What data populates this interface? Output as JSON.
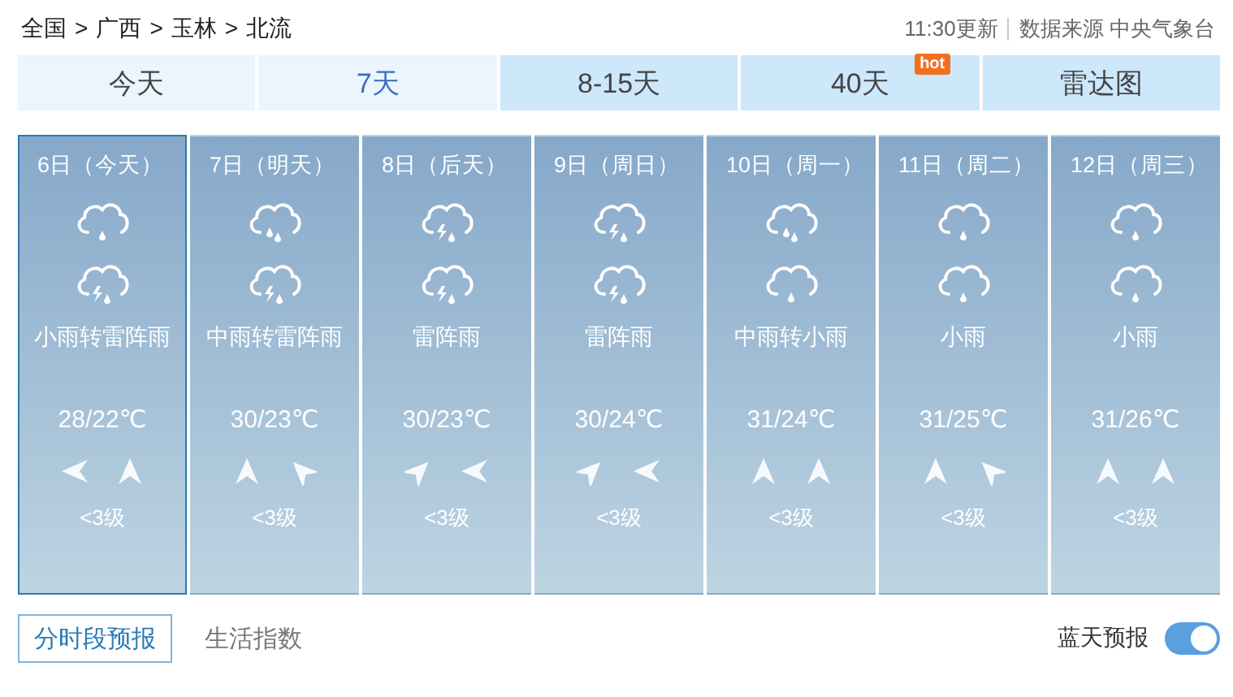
{
  "breadcrumb": [
    "全国",
    "广西",
    "玉林",
    "北流"
  ],
  "breadcrumb_separator": ">",
  "update_time": "11:30更新",
  "source": "数据来源 中央气象台",
  "tabs": [
    {
      "label": "今天",
      "selected": false,
      "kind": "basic"
    },
    {
      "label": "7天",
      "selected": true,
      "kind": "basic"
    },
    {
      "label": "8-15天",
      "selected": false,
      "kind": "extended"
    },
    {
      "label": "40天",
      "selected": false,
      "kind": "extended",
      "badge": "hot"
    },
    {
      "label": "雷达图",
      "selected": false,
      "kind": "extended"
    }
  ],
  "days": [
    {
      "date": "6日（今天）",
      "selected": true,
      "icons": [
        {
          "kind": "light"
        },
        {
          "kind": "thunder"
        }
      ],
      "weather": "小雨转雷阵雨",
      "temp": "28/22℃",
      "winds": [
        {
          "kind": "w"
        },
        {
          "kind": "n"
        }
      ],
      "wind_level": "<3级"
    },
    {
      "date": "7日（明天）",
      "selected": false,
      "icons": [
        {
          "kind": "moderate"
        },
        {
          "kind": "thunder"
        }
      ],
      "weather": "中雨转雷阵雨",
      "temp": "30/23℃",
      "winds": [
        {
          "kind": "n"
        },
        {
          "kind": "nw"
        }
      ],
      "wind_level": "<3级"
    },
    {
      "date": "8日（后天）",
      "selected": false,
      "icons": [
        {
          "kind": "thunder"
        },
        {
          "kind": "thunder"
        }
      ],
      "weather": "雷阵雨",
      "temp": "30/23℃",
      "winds": [
        {
          "kind": "ne"
        },
        {
          "kind": "w"
        }
      ],
      "wind_level": "<3级"
    },
    {
      "date": "9日（周日）",
      "selected": false,
      "icons": [
        {
          "kind": "thunder"
        },
        {
          "kind": "thunder"
        }
      ],
      "weather": "雷阵雨",
      "temp": "30/24℃",
      "winds": [
        {
          "kind": "ne"
        },
        {
          "kind": "w"
        }
      ],
      "wind_level": "<3级"
    },
    {
      "date": "10日（周一）",
      "selected": false,
      "icons": [
        {
          "kind": "moderate"
        },
        {
          "kind": "light"
        }
      ],
      "weather": "中雨转小雨",
      "temp": "31/24℃",
      "winds": [
        {
          "kind": "n"
        },
        {
          "kind": "n"
        }
      ],
      "wind_level": "<3级"
    },
    {
      "date": "11日（周二）",
      "selected": false,
      "icons": [
        {
          "kind": "light"
        },
        {
          "kind": "light"
        }
      ],
      "weather": "小雨",
      "temp": "31/25℃",
      "winds": [
        {
          "kind": "n"
        },
        {
          "kind": "nw"
        }
      ],
      "wind_level": "<3级"
    },
    {
      "date": "12日（周三）",
      "selected": false,
      "icons": [
        {
          "kind": "light"
        },
        {
          "kind": "light"
        }
      ],
      "weather": "小雨",
      "temp": "31/26℃",
      "winds": [
        {
          "kind": "n"
        },
        {
          "kind": "n"
        }
      ],
      "wind_level": "<3级"
    }
  ],
  "subtabs": [
    {
      "label": "分时段预报",
      "selected": true
    },
    {
      "label": "生活指数",
      "selected": false
    }
  ],
  "toggle": {
    "label": "蓝天预报",
    "on": true
  }
}
